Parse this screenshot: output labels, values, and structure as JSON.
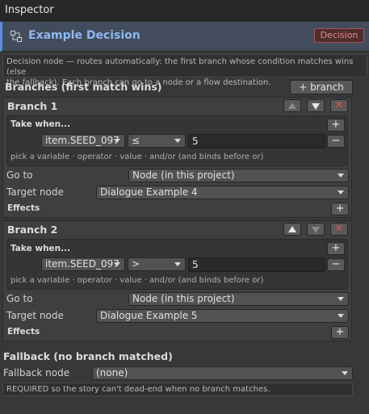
{
  "inspector": {
    "title": "Inspector"
  },
  "node": {
    "title": "Example Decision",
    "badge": "Decision",
    "description_line1": "Decision node — routes automatically: the first branch whose condition matches wins (else",
    "description_line2": "the fallback). Each branch can go to a node or a flow destination."
  },
  "branches": {
    "header": "Branches (first match wins)",
    "add_label": "+ branch",
    "items": [
      {
        "title": "Branch 1",
        "take_when": "Take when...",
        "variable": "item.SEED_097",
        "operator": "≤",
        "value": "5",
        "hint": "pick a variable · operator · value · and/or  (and binds before or)",
        "goto_label": "Go to",
        "goto_value": "Node (in this project)",
        "target_label": "Target node",
        "target_value": "Dialogue Example 4",
        "effects_label": "Effects"
      },
      {
        "title": "Branch 2",
        "take_when": "Take when...",
        "variable": "item.SEED_097",
        "operator": ">",
        "value": "5",
        "hint": "pick a variable · operator · value · and/or  (and binds before or)",
        "goto_label": "Go to",
        "goto_value": "Node (in this project)",
        "target_label": "Target node",
        "target_value": "Dialogue Example 5",
        "effects_label": "Effects"
      }
    ]
  },
  "fallback": {
    "header": "Fallback (no branch matched)",
    "label": "Fallback node",
    "value": "(none)",
    "note": "REQUIRED so the story can't dead-end when no branch matches."
  },
  "glyphs": {
    "plus": "+",
    "minus": "−",
    "close": "✕"
  },
  "colors": {
    "accent": "#5b8ed8",
    "title_text": "#8eb8ef",
    "badge_border": "#a65454",
    "remove_red": "#e05050"
  }
}
